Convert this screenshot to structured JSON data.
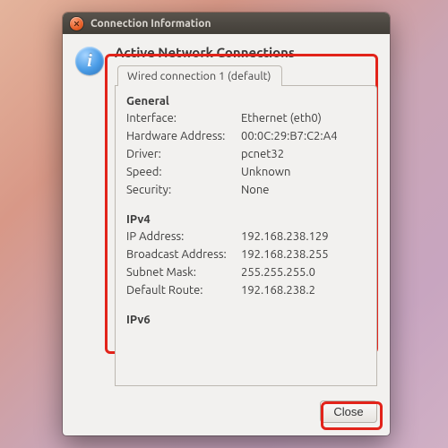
{
  "window": {
    "title": "Connection Information"
  },
  "heading": "Active Network Connections",
  "tab_label": "Wired connection 1 (default)",
  "sections": {
    "general": {
      "title": "General",
      "interface_k": "Interface:",
      "interface_v": "Ethernet (eth0)",
      "hwaddr_k": "Hardware Address:",
      "hwaddr_v": "00:0C:29:B7:C2:A4",
      "driver_k": "Driver:",
      "driver_v": "pcnet32",
      "speed_k": "Speed:",
      "speed_v": "Unknown",
      "security_k": "Security:",
      "security_v": "None"
    },
    "ipv4": {
      "title": "IPv4",
      "ip_k": "IP Address:",
      "ip_v": "192.168.238.129",
      "bcast_k": "Broadcast Address:",
      "bcast_v": "192.168.238.255",
      "mask_k": "Subnet Mask:",
      "mask_v": "255.255.255.0",
      "route_k": "Default Route:",
      "route_v": "192.168.238.2"
    },
    "ipv6": {
      "title": "IPv6"
    }
  },
  "buttons": {
    "close": "Close"
  }
}
